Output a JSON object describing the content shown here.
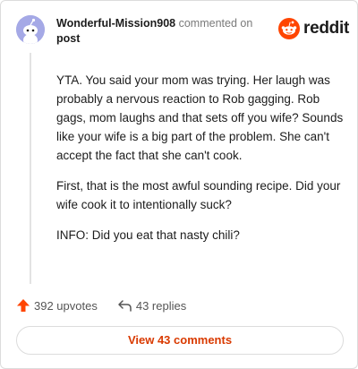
{
  "comment": {
    "username": "Wonderful-Mission908",
    "action_text": "commented on",
    "post_link": "post",
    "avatar_icon": "reddit-snoo-avatar-icon",
    "paragraphs": [
      "YTA. You said your mom was trying. Her laugh was probably a nervous reaction to Rob gagging. Rob gags, mom laughs and that sets off you wife? Sounds like your wife is a big part of the problem. She can't accept the fact that she can't cook.",
      "First, that is the most awful sounding recipe. Did your wife cook it to intentionally suck?",
      "INFO: Did you eat that nasty chili?"
    ]
  },
  "brand": {
    "name": "reddit",
    "icon": "reddit-logo-icon",
    "color": "#ff4500"
  },
  "actions": {
    "upvotes": "392 upvotes",
    "upvote_icon": "upvote-arrow-icon",
    "upvote_color": "#ff4500",
    "replies": "43 replies",
    "reply_icon": "reply-arrow-icon"
  },
  "footer": {
    "view_comments_label": "View 43 comments",
    "accent": "#d93a00"
  }
}
